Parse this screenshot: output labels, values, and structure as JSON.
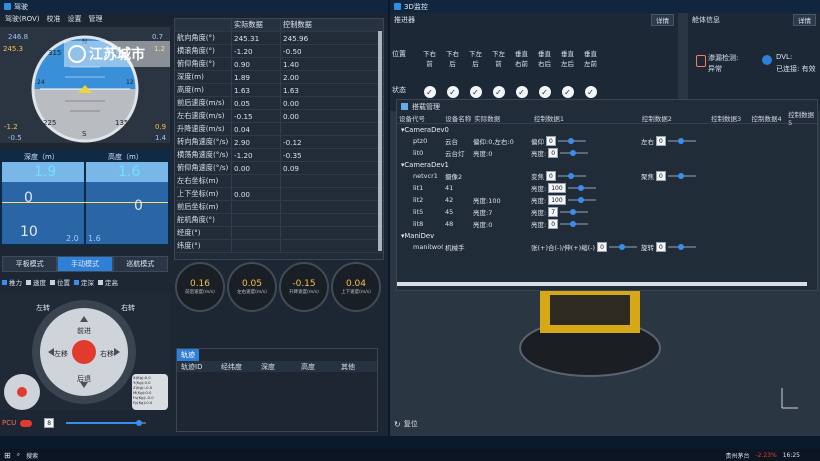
{
  "left_window": {
    "title": "驾驶",
    "menu": [
      "驾驶(ROV)",
      "校准",
      "设置",
      "管理"
    ],
    "attitude": {
      "left_top": "246.8",
      "left_top2": "245.3",
      "right_top": "0.7",
      "right_top2": "1.2",
      "left_bottom": "-1.2",
      "left_bottom2": "-0.5",
      "right_bottom": "0.9",
      "right_bottom2": "1.4",
      "compass_ticks": [
        "315",
        "N",
        "45"
      ],
      "side_ticks": [
        "24",
        "12"
      ],
      "bottom_ticks": [
        "225",
        "S",
        "135"
      ],
      "watermark": "江苏城市"
    },
    "depth_label": "深度（m）",
    "height_label": "高度（m）",
    "depth_value": "1.9",
    "height_value": "1.6",
    "depth_zero": "0",
    "height_zero": "0",
    "depth_bottom": "10",
    "depth_foot": "2.0",
    "height_foot": "1.6",
    "modes": [
      "平板模式",
      "手动模式",
      "巡航模式"
    ],
    "checks": [
      "推力",
      "速度",
      "位置",
      "定深",
      "定高"
    ],
    "joystick": {
      "up": "前进",
      "down": "后退",
      "left": "左移",
      "right": "右移",
      "rot_left": "左转",
      "rot_right": "右转"
    },
    "mini_readout": [
      "X(Kg):0.0",
      "Y(Kg):0.0",
      "Z(Kg):-0.0",
      "M(Kg):0.0",
      "Fs(Kg):-0.0",
      "Fy(Kg):0.0"
    ],
    "pcu_label": "PCU",
    "pcu_value": "8",
    "table": {
      "headers": [
        "",
        "实际数据",
        "控制数据"
      ],
      "rows": [
        [
          "航向角度(°)",
          "245.31",
          "245.96"
        ],
        [
          "横滚角度(°)",
          "-1.20",
          "-0.50"
        ],
        [
          "俯仰角度(°)",
          "0.90",
          "1.40"
        ],
        [
          "深度(m)",
          "1.89",
          "2.00"
        ],
        [
          "高度(m)",
          "1.63",
          "1.63"
        ],
        [
          "前后速度(m/s)",
          "0.05",
          "0.00"
        ],
        [
          "左右速度(m/s)",
          "-0.15",
          "0.00"
        ],
        [
          "升降速度(m/s)",
          "0.04",
          ""
        ],
        [
          "转向角速度(°/s)",
          "2.90",
          "-0.12"
        ],
        [
          "横荡角速度(°/s)",
          "-1.20",
          "-0.35"
        ],
        [
          "俯仰角速度(°/s)",
          "0.00",
          "0.09"
        ],
        [
          "左右坐标(m)",
          "",
          ""
        ],
        [
          "上下坐标(m)",
          "0.00",
          ""
        ],
        [
          "前后坐标(m)",
          "",
          ""
        ],
        [
          "舵机角度(°)",
          "",
          ""
        ],
        [
          "经度(°)",
          "",
          ""
        ],
        [
          "纬度(°)",
          "",
          ""
        ]
      ]
    },
    "gauges": [
      {
        "value": "0.16",
        "label": "前后速度(m/s)"
      },
      {
        "value": "0.05",
        "label": "左右速度(m/s)"
      },
      {
        "value": "-0.15",
        "label": "升降速度(m/s)"
      },
      {
        "value": "0.04",
        "label": "上下速度(m/s)"
      }
    ],
    "track": {
      "tab": "轨迹",
      "headers": [
        "轨迹ID",
        "经纬度",
        "深度",
        "高度",
        "其他"
      ]
    }
  },
  "right_window": {
    "title": "3D监控",
    "thrusters": {
      "title": "推进器",
      "details": "详情",
      "row_label": "位置",
      "status_label": "状态",
      "labels": [
        "下右前",
        "下右后",
        "下左后",
        "下左前",
        "垂直右前",
        "垂直右后",
        "垂直左后",
        "垂直左前"
      ]
    },
    "body": {
      "title": "舱体信息",
      "details": "详情",
      "leak": "渗漏检测:",
      "leak_status": "异常",
      "dvl": "DVL:",
      "dvl_status": "已连接: 有效"
    },
    "mount": {
      "title": "搭载管理",
      "headers": [
        "设备代号",
        "设备名称",
        "实际数据",
        "控制数据1",
        "控制数据2",
        "控制数据3",
        "控制数据4",
        "控制数据5"
      ],
      "groups": [
        {
          "name": "CameraDev0",
          "rows": [
            {
              "code": "ptz0",
              "name": "云台",
              "actual": "偏仰:0,左右:0",
              "c1_label": "偏仰",
              "c1": "0",
              "c2_label": "左右",
              "c2": "0"
            },
            {
              "code": "lit0",
              "name": "云台灯",
              "actual": "亮度:0",
              "c1_label": "亮度:",
              "c1": "0",
              "c2_label": "",
              "c2": ""
            }
          ]
        },
        {
          "name": "CameraDev1",
          "rows": [
            {
              "code": "netvcr1",
              "name": "摄像2",
              "actual": "",
              "c1_label": "变焦",
              "c1": "0",
              "c2_label": "聚焦",
              "c2": "0"
            },
            {
              "code": "lit1",
              "name": "41",
              "actual": "",
              "c1_label": "亮度:",
              "c1": "100",
              "c2_label": "",
              "c2": ""
            },
            {
              "code": "lit2",
              "name": "42",
              "actual": "亮度:100",
              "c1_label": "亮度:",
              "c1": "100",
              "c2_label": "",
              "c2": ""
            },
            {
              "code": "lit5",
              "name": "45",
              "actual": "亮度:7",
              "c1_label": "亮度:",
              "c1": "7",
              "c2_label": "",
              "c2": ""
            },
            {
              "code": "lit8",
              "name": "48",
              "actual": "亮度:0",
              "c1_label": "亮度:",
              "c1": "0",
              "c2_label": "",
              "c2": ""
            }
          ]
        },
        {
          "name": "ManiDev",
          "rows": [
            {
              "code": "manitwo0",
              "name": "机械手",
              "actual": "",
              "c1_label": "张(+)合(-)/伸(+)缩(-)",
              "c1": "0",
              "c2_label": "旋转",
              "c2": "0"
            }
          ]
        }
      ]
    },
    "reset": "复位"
  },
  "taskbar": {
    "search": "搜索",
    "weather": "贵州茅台",
    "change": "-2.23%",
    "time": "16:25"
  },
  "colors": {
    "accent": "#2e7fd6",
    "gauge_value": "#f2c14e",
    "joystick_center": "#e23b2e"
  }
}
